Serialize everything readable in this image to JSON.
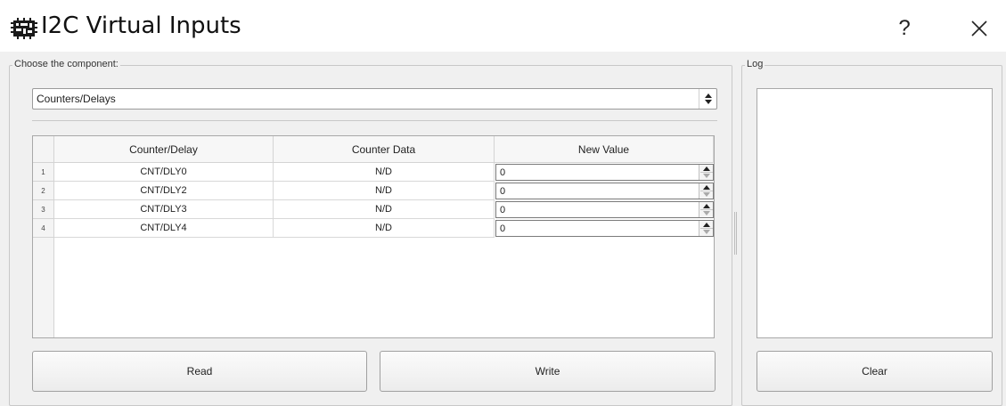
{
  "window": {
    "title": "I2C Virtual Inputs",
    "help_label": "?",
    "close_label": "×"
  },
  "component_group": {
    "legend": "Choose the component:",
    "selected": "Counters/Delays"
  },
  "table": {
    "headers": [
      "Counter/Delay",
      "Counter Data",
      "New Value"
    ],
    "rows": [
      {
        "index": "1",
        "name": "CNT/DLY0",
        "data": "N/D",
        "value": "0"
      },
      {
        "index": "2",
        "name": "CNT/DLY2",
        "data": "N/D",
        "value": "0"
      },
      {
        "index": "3",
        "name": "CNT/DLY3",
        "data": "N/D",
        "value": "0"
      },
      {
        "index": "4",
        "name": "CNT/DLY4",
        "data": "N/D",
        "value": "0"
      }
    ]
  },
  "buttons": {
    "read": "Read",
    "write": "Write",
    "clear": "Clear"
  },
  "log_group": {
    "legend": "Log"
  },
  "icons": {
    "app": "chip-icon",
    "help": "question-icon",
    "close": "close-icon",
    "combo_arrow": "updown-arrow-icon",
    "spin": "spinbox-arrows-icon"
  }
}
